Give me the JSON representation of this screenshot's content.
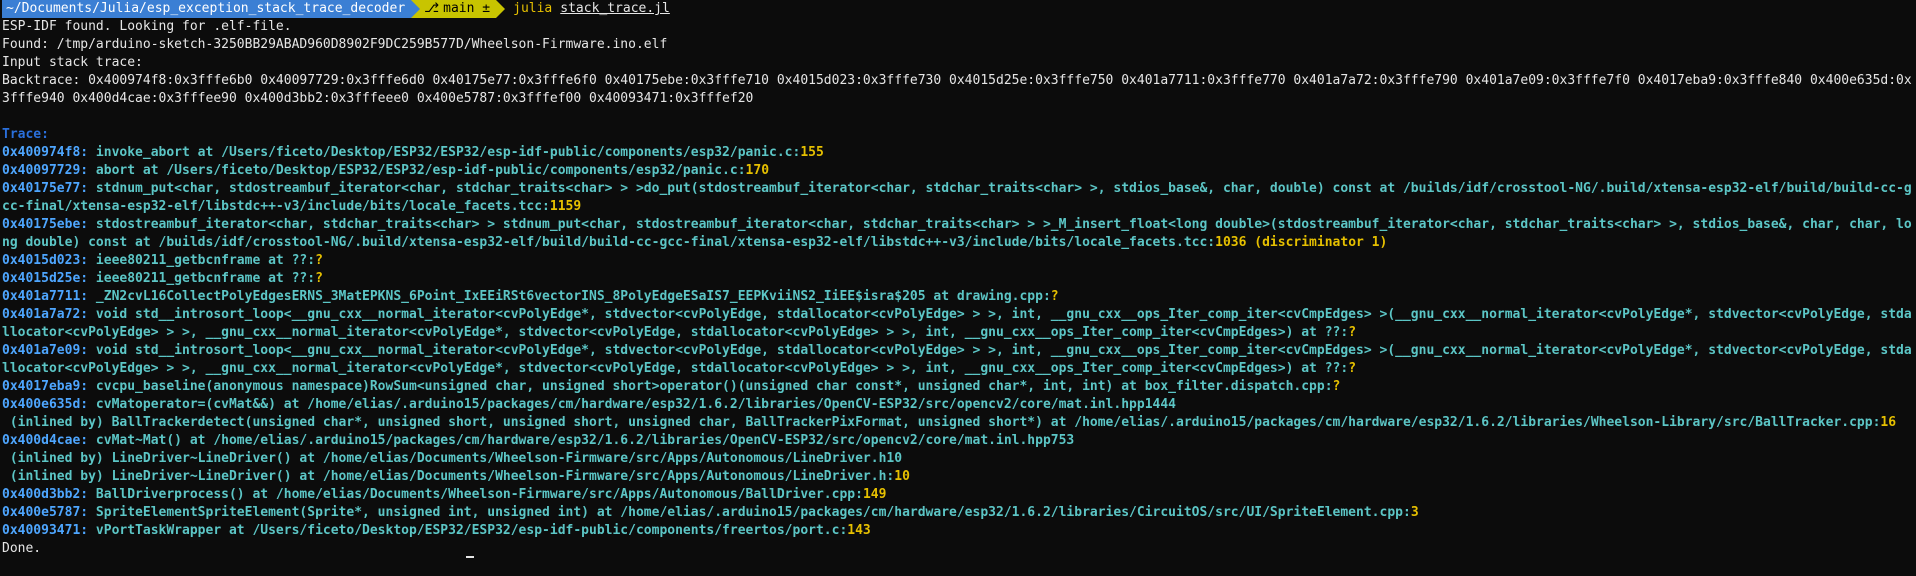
{
  "prompt": {
    "path": "~/Documents/Julia/esp_exception_stack_trace_decoder",
    "branch_icon": "git-branch-icon",
    "branch": "main ±",
    "command": "julia",
    "argument": "stack_trace.jl"
  },
  "output": {
    "line1": "ESP-IDF found. Looking for .elf-file.",
    "line2": "Found: /tmp/arduino-sketch-3250BB29ABAD960D8902F9DC259B577D/Wheelson-Firmware.ino.elf",
    "line3": "Input stack trace:",
    "backtrace": "Backtrace: 0x400974f8:0x3fffe6b0 0x40097729:0x3fffe6d0 0x40175e77:0x3fffe6f0 0x40175ebe:0x3fffe710 0x4015d023:0x3fffe730 0x4015d25e:0x3fffe750 0x401a7711:0x3fffe770 0x401a7a72:0x3fffe790 0x401a7e09:0x3fffe7f0 0x4017eba9:0x3fffe840 0x400e635d:0x3fffe940 0x400d4cae:0x3fffee90 0x400d3bb2:0x3fffeee0 0x400e5787:0x3fffef00 0x40093471:0x3fffef20",
    "trace_heading": "Trace:",
    "done": "Done."
  },
  "trace": [
    {
      "addr": "0x400974f8:",
      "text": " invoke_abort at /Users/ficeto/Desktop/ESP32/ESP32/esp-idf-public/components/esp32/panic.c:",
      "num": "155"
    },
    {
      "addr": "0x40097729:",
      "text": " abort at /Users/ficeto/Desktop/ESP32/ESP32/esp-idf-public/components/esp32/panic.c:",
      "num": "170"
    },
    {
      "addr": "0x40175e77:",
      "text": " stdnum_put<char, stdostreambuf_iterator<char, stdchar_traits<char> > >do_put(stdostreambuf_iterator<char, stdchar_traits<char> >, stdios_base&, char, double) const at /builds/idf/crosstool-NG/.build/xtensa-esp32-elf/build/build-cc-gcc-final/xtensa-esp32-elf/libstdc++-v3/include/bits/locale_facets.tcc:",
      "num": "1159"
    },
    {
      "addr": "0x40175ebe:",
      "text": " stdostreambuf_iterator<char, stdchar_traits<char> > stdnum_put<char, stdostreambuf_iterator<char, stdchar_traits<char> > >_M_insert_float<long double>(stdostreambuf_iterator<char, stdchar_traits<char> >, stdios_base&, char, char, long double) const at /builds/idf/crosstool-NG/.build/xtensa-esp32-elf/build/build-cc-gcc-final/xtensa-esp32-elf/libstdc++-v3/include/bits/locale_facets.tcc:",
      "num": "1036 (discriminator 1)"
    },
    {
      "addr": "0x4015d023:",
      "text": " ieee80211_getbcnframe at ??:",
      "num": "?"
    },
    {
      "addr": "0x4015d25e:",
      "text": " ieee80211_getbcnframe at ??:",
      "num": "?"
    },
    {
      "addr": "0x401a7711:",
      "text": " _ZN2cvL16CollectPolyEdgesERNS_3MatEPKNS_6Point_IxEEiRSt6vectorINS_8PolyEdgeESaIS7_EEPKviiNS2_IiEE$isra$205 at drawing.cpp:",
      "num": "?"
    },
    {
      "addr": "0x401a7a72:",
      "text": " void std__introsort_loop<__gnu_cxx__normal_iterator<cvPolyEdge*, stdvector<cvPolyEdge, stdallocator<cvPolyEdge> > >, int, __gnu_cxx__ops_Iter_comp_iter<cvCmpEdges> >(__gnu_cxx__normal_iterator<cvPolyEdge*, stdvector<cvPolyEdge, stdallocator<cvPolyEdge> > >, __gnu_cxx__normal_iterator<cvPolyEdge*, stdvector<cvPolyEdge, stdallocator<cvPolyEdge> > >, int, __gnu_cxx__ops_Iter_comp_iter<cvCmpEdges>) at ??:",
      "num": "?"
    },
    {
      "addr": "0x401a7e09:",
      "text": " void std__introsort_loop<__gnu_cxx__normal_iterator<cvPolyEdge*, stdvector<cvPolyEdge, stdallocator<cvPolyEdge> > >, int, __gnu_cxx__ops_Iter_comp_iter<cvCmpEdges> >(__gnu_cxx__normal_iterator<cvPolyEdge*, stdvector<cvPolyEdge, stdallocator<cvPolyEdge> > >, __gnu_cxx__normal_iterator<cvPolyEdge*, stdvector<cvPolyEdge, stdallocator<cvPolyEdge> > >, int, __gnu_cxx__ops_Iter_comp_iter<cvCmpEdges>) at ??:",
      "num": "?"
    },
    {
      "addr": "0x4017eba9:",
      "text": " cvcpu_baseline(anonymous namespace)RowSum<unsigned char, unsigned short>operator()(unsigned char const*, unsigned char*, int, int) at box_filter.dispatch.cpp:",
      "num": "?"
    },
    {
      "addr": "0x400e635d:",
      "text": " cvMatoperator=(cvMat&&) at /home/elias/.arduino15/packages/cm/hardware/esp32/1.6.2/libraries/OpenCV-ESP32/src/opencv2/core/mat.inl.hpp1444",
      "num": ""
    },
    {
      "addr": "",
      "text": " (inlined by) BallTrackerdetect(unsigned char*, unsigned short, unsigned short, unsigned char, BallTrackerPixFormat, unsigned short*) at /home/elias/.arduino15/packages/cm/hardware/esp32/1.6.2/libraries/Wheelson-Library/src/BallTracker.cpp:",
      "num": "16"
    },
    {
      "addr": "0x400d4cae:",
      "text": " cvMat~Mat() at /home/elias/.arduino15/packages/cm/hardware/esp32/1.6.2/libraries/OpenCV-ESP32/src/opencv2/core/mat.inl.hpp753",
      "num": ""
    },
    {
      "addr": "",
      "text": " (inlined by) LineDriver~LineDriver() at /home/elias/Documents/Wheelson-Firmware/src/Apps/Autonomous/LineDriver.h10",
      "num": ""
    },
    {
      "addr": "",
      "text": " (inlined by) LineDriver~LineDriver() at /home/elias/Documents/Wheelson-Firmware/src/Apps/Autonomous/LineDriver.h:",
      "num": "10"
    },
    {
      "addr": "0x400d3bb2:",
      "text": " BallDriverprocess() at /home/elias/Documents/Wheelson-Firmware/src/Apps/Autonomous/BallDriver.cpp:",
      "num": "149"
    },
    {
      "addr": "0x400e5787:",
      "text": " SpriteElementSpriteElement(Sprite*, unsigned int, unsigned int) at /home/elias/.arduino15/packages/cm/hardware/esp32/1.6.2/libraries/CircuitOS/src/UI/SpriteElement.cpp:",
      "num": "3"
    },
    {
      "addr": "0x40093471:",
      "text": " vPortTaskWrapper at /Users/ficeto/Desktop/ESP32/ESP32/esp-idf-public/components/freertos/port.c:",
      "num": "143"
    }
  ]
}
